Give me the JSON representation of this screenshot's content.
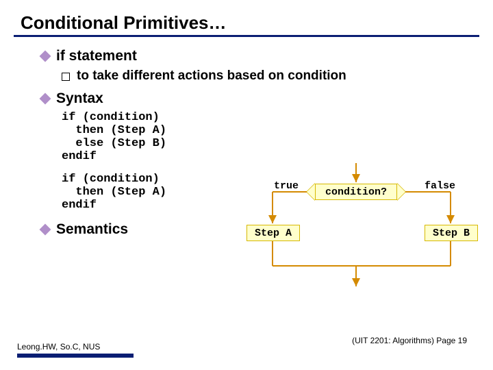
{
  "title": "Conditional Primitives…",
  "bullets": {
    "if_statement": "if statement",
    "sub_condition": "to take different actions based on condition",
    "syntax": "Syntax",
    "semantics": "Semantics"
  },
  "code1": "if (condition)\n  then (Step A)\n  else (Step B)\nendif",
  "code2": "if (condition)\n  then (Step A)\nendif",
  "flow": {
    "condition": "condition?",
    "true": "true",
    "false": "false",
    "step_a": "Step A",
    "step_b": "Step B"
  },
  "footer": {
    "right": "(UIT 2201: Algorithms) Page 19",
    "left": "Leong.HW, So.C, NUS"
  }
}
